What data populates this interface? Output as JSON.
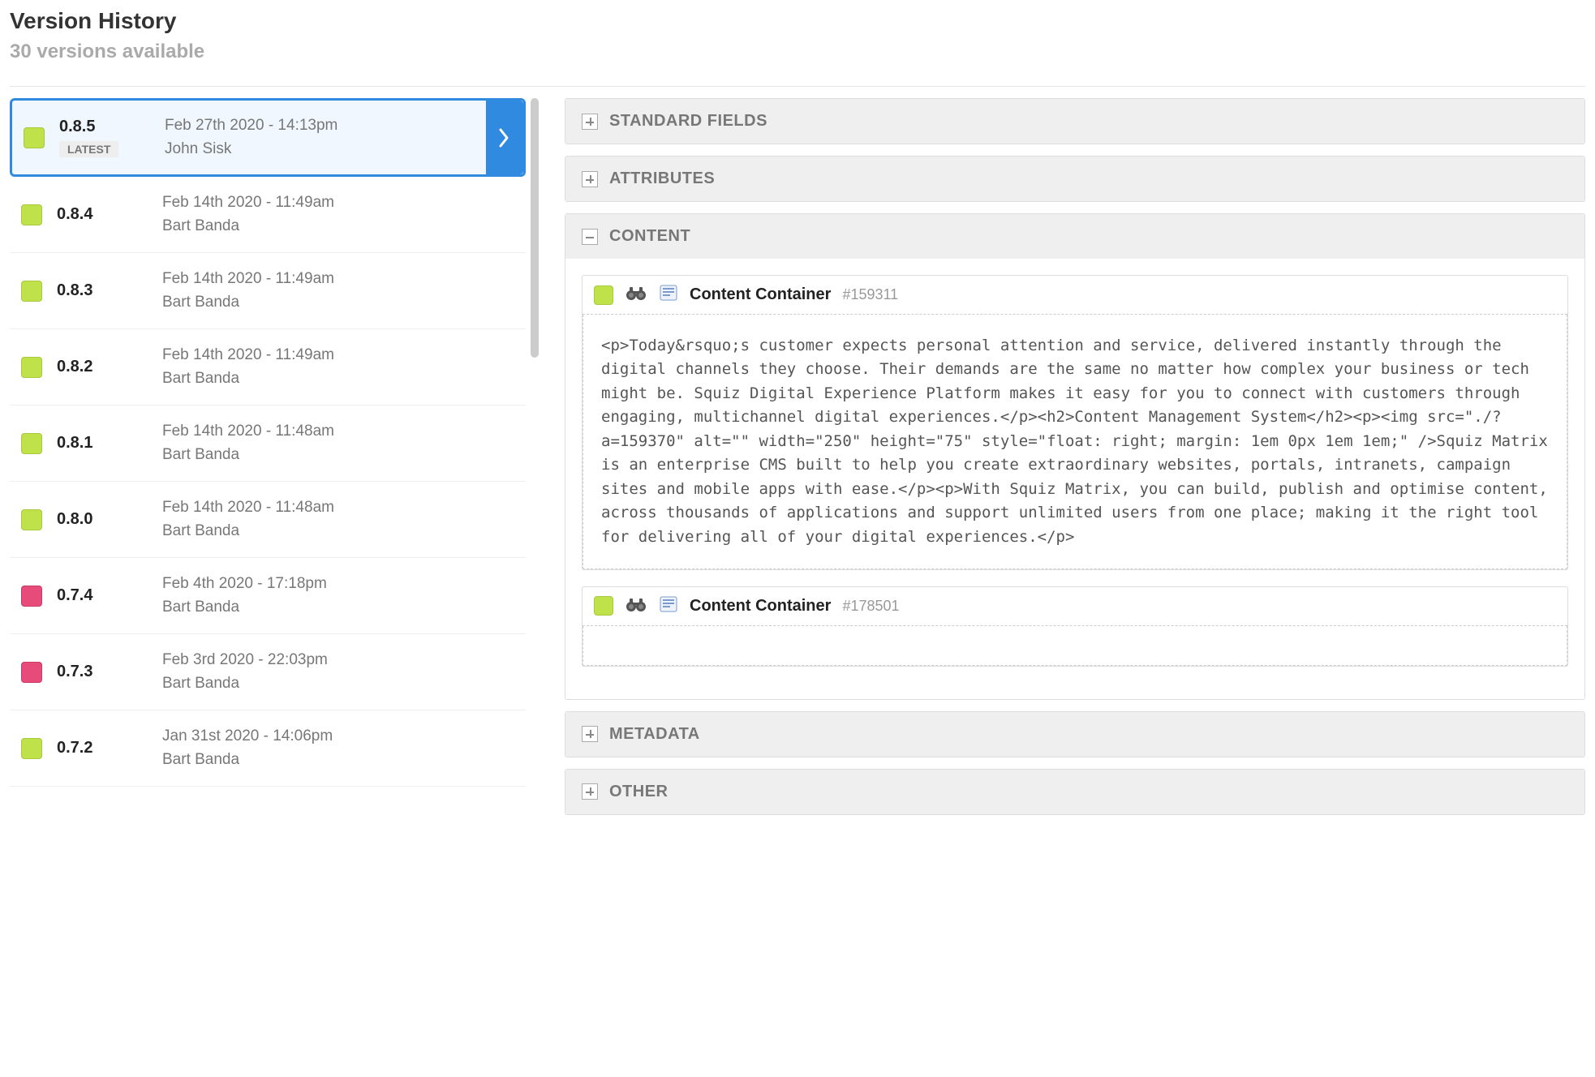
{
  "header": {
    "title": "Version History",
    "count_text": "30 versions available",
    "latest_label": "LATEST"
  },
  "versions": [
    {
      "num": "0.8.5",
      "date": "Feb 27th 2020 - 14:13pm",
      "author": "John Sisk",
      "status": "green",
      "selected": true,
      "latest": true
    },
    {
      "num": "0.8.4",
      "date": "Feb 14th 2020 - 11:49am",
      "author": "Bart Banda",
      "status": "green",
      "selected": false,
      "latest": false
    },
    {
      "num": "0.8.3",
      "date": "Feb 14th 2020 - 11:49am",
      "author": "Bart Banda",
      "status": "green",
      "selected": false,
      "latest": false
    },
    {
      "num": "0.8.2",
      "date": "Feb 14th 2020 - 11:49am",
      "author": "Bart Banda",
      "status": "green",
      "selected": false,
      "latest": false
    },
    {
      "num": "0.8.1",
      "date": "Feb 14th 2020 - 11:48am",
      "author": "Bart Banda",
      "status": "green",
      "selected": false,
      "latest": false
    },
    {
      "num": "0.8.0",
      "date": "Feb 14th 2020 - 11:48am",
      "author": "Bart Banda",
      "status": "green",
      "selected": false,
      "latest": false
    },
    {
      "num": "0.7.4",
      "date": "Feb 4th 2020 - 17:18pm",
      "author": "Bart Banda",
      "status": "pink",
      "selected": false,
      "latest": false
    },
    {
      "num": "0.7.3",
      "date": "Feb 3rd 2020 - 22:03pm",
      "author": "Bart Banda",
      "status": "pink",
      "selected": false,
      "latest": false
    },
    {
      "num": "0.7.2",
      "date": "Jan 31st 2020 - 14:06pm",
      "author": "Bart Banda",
      "status": "green",
      "selected": false,
      "latest": false
    }
  ],
  "panels": {
    "standard_fields": {
      "title": "STANDARD FIELDS",
      "expanded": false
    },
    "attributes": {
      "title": "ATTRIBUTES",
      "expanded": false
    },
    "content": {
      "title": "CONTENT",
      "expanded": true
    },
    "metadata": {
      "title": "METADATA",
      "expanded": false
    },
    "other": {
      "title": "OTHER",
      "expanded": false
    }
  },
  "content_containers": [
    {
      "title": "Content Container",
      "id": "#159311",
      "body": "<p>Today&rsquo;s customer expects personal attention and service, delivered instantly through the digital channels they choose. Their demands are the same no matter how complex your business or tech might be. Squiz Digital Experience Platform makes it easy for you to connect with customers through engaging, multichannel digital experiences.</p><h2>Content Management System</h2><p><img src=\"./?a=159370\" alt=\"\" width=\"250\" height=\"75\" style=\"float: right; margin: 1em 0px 1em 1em;\" />Squiz Matrix is an enterprise CMS built to help you create extraordinary websites, portals, intranets, campaign sites and mobile apps with ease.</p><p>With Squiz Matrix, you can build, publish and optimise content, across thousands of applications and support unlimited users from one place; making it the right tool for delivering all of your digital experiences.</p>"
    },
    {
      "title": "Content Container",
      "id": "#178501",
      "body": ""
    }
  ]
}
